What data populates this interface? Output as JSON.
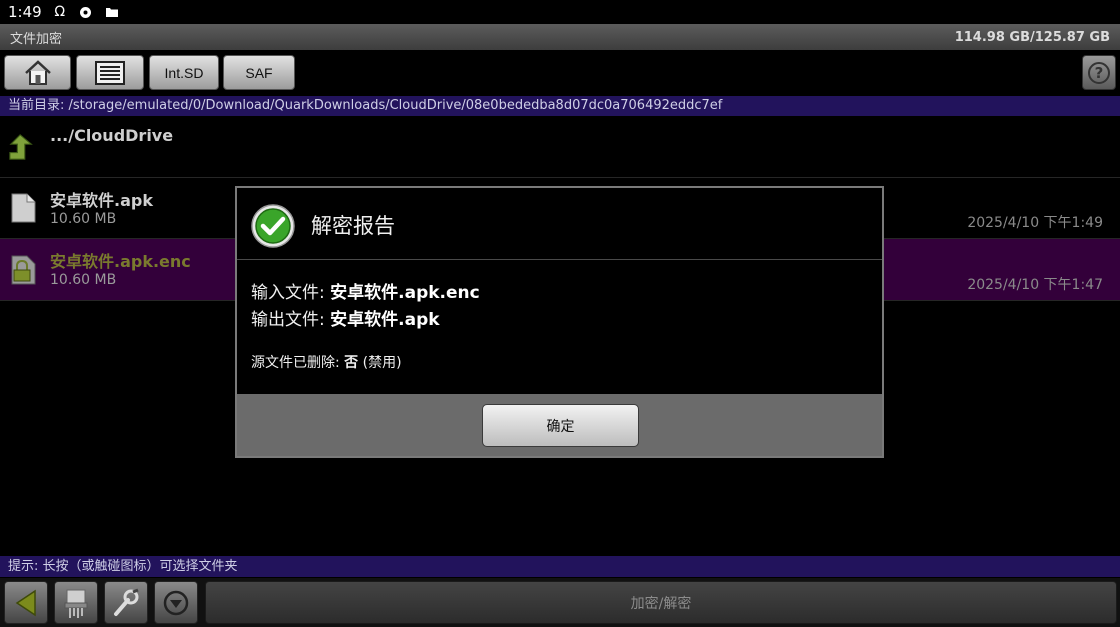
{
  "status_bar": {
    "time": "1:49"
  },
  "title_bar": {
    "app_title": "文件加密",
    "storage": "114.98 GB/125.87 GB"
  },
  "toolbar": {
    "int_sd_label": "Int.SD",
    "saf_label": "SAF",
    "help_label": "?"
  },
  "path": {
    "label": "当前目录: /storage/emulated/0/Download/QuarkDownloads/CloudDrive/08e0bededba8d07dc0a706492eddc7ef"
  },
  "files": [
    {
      "name": ".../CloudDrive",
      "size": "",
      "date": ""
    },
    {
      "name": "安卓软件.apk",
      "size": "10.60 MB",
      "date": "2025/4/10 下午1:49"
    },
    {
      "name": "安卓软件.apk.enc",
      "size": "10.60 MB",
      "date": "2025/4/10 下午1:47"
    }
  ],
  "dialog": {
    "title": "解密报告",
    "input_label": "输入文件: ",
    "input_value": "安卓软件.apk.enc",
    "output_label": "输出文件: ",
    "output_value": "安卓软件.apk",
    "deleted_label": "源文件已删除: ",
    "deleted_value": "否",
    "deleted_note": " (禁用)",
    "ok_label": "确定"
  },
  "hint": "提示: 长按（或触碰图标）可选择文件夹",
  "bottom_bar": {
    "action_label": "加密/解密"
  },
  "colors": {
    "path_bar": "#22135c",
    "selected_row": "#33003a",
    "check_green": "#3aa52a"
  }
}
